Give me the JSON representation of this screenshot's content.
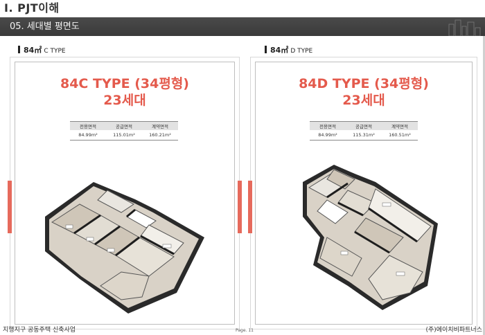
{
  "header": {
    "page_title": "Ⅰ. PJT이해",
    "section_title": "05. 세대별 평면도"
  },
  "panels": [
    {
      "area_label": "84㎡",
      "type_code": "C TYPE",
      "title_line1": "84C TYPE (34평형)",
      "title_line2": "23세대",
      "table": {
        "headers": [
          "전용면적",
          "공급면적",
          "계약면적"
        ],
        "values": [
          "84.99m²",
          "115.01m²",
          "160.21m²"
        ]
      }
    },
    {
      "area_label": "84㎡",
      "type_code": "D TYPE",
      "title_line1": "84D TYPE (34평형)",
      "title_line2": "23세대",
      "table": {
        "headers": [
          "전용면적",
          "공급면적",
          "계약면적"
        ],
        "values": [
          "84.99m²",
          "115.31m²",
          "160.51m²"
        ]
      }
    }
  ],
  "footer": {
    "left": "지행지구 공동주택 신축사업",
    "page": "Page. 11",
    "right": "(주)에이치비파트너스"
  },
  "colors": {
    "accent": "#e45a4c",
    "section_bar": "#3f3f3f"
  }
}
